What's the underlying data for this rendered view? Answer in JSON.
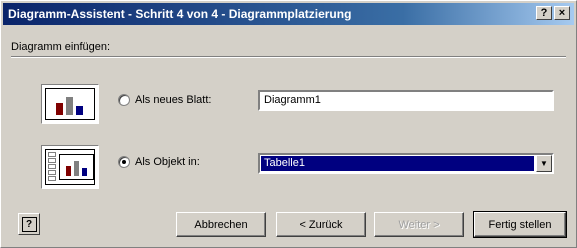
{
  "window": {
    "title": "Diagramm-Assistent - Schritt 4 von 4 - Diagrammplatzierung",
    "help_glyph": "?",
    "close_glyph": "×"
  },
  "group": {
    "label": "Diagramm einfügen:"
  },
  "option_new_sheet": {
    "label": "Als neues Blatt:",
    "selected": false,
    "value": "Diagramm1"
  },
  "option_object": {
    "label": "Als Objekt in:",
    "selected": true,
    "value": "Tabelle1",
    "dropdown_glyph": "▼"
  },
  "buttons": {
    "help": "?",
    "cancel": "Abbrechen",
    "back": "< Zurück",
    "next": "Weiter >",
    "finish": "Fertig stellen"
  },
  "colors": {
    "title_start": "#0a246a",
    "title_end": "#a6caf0",
    "face": "#d4d0c8",
    "selection": "#000080"
  }
}
